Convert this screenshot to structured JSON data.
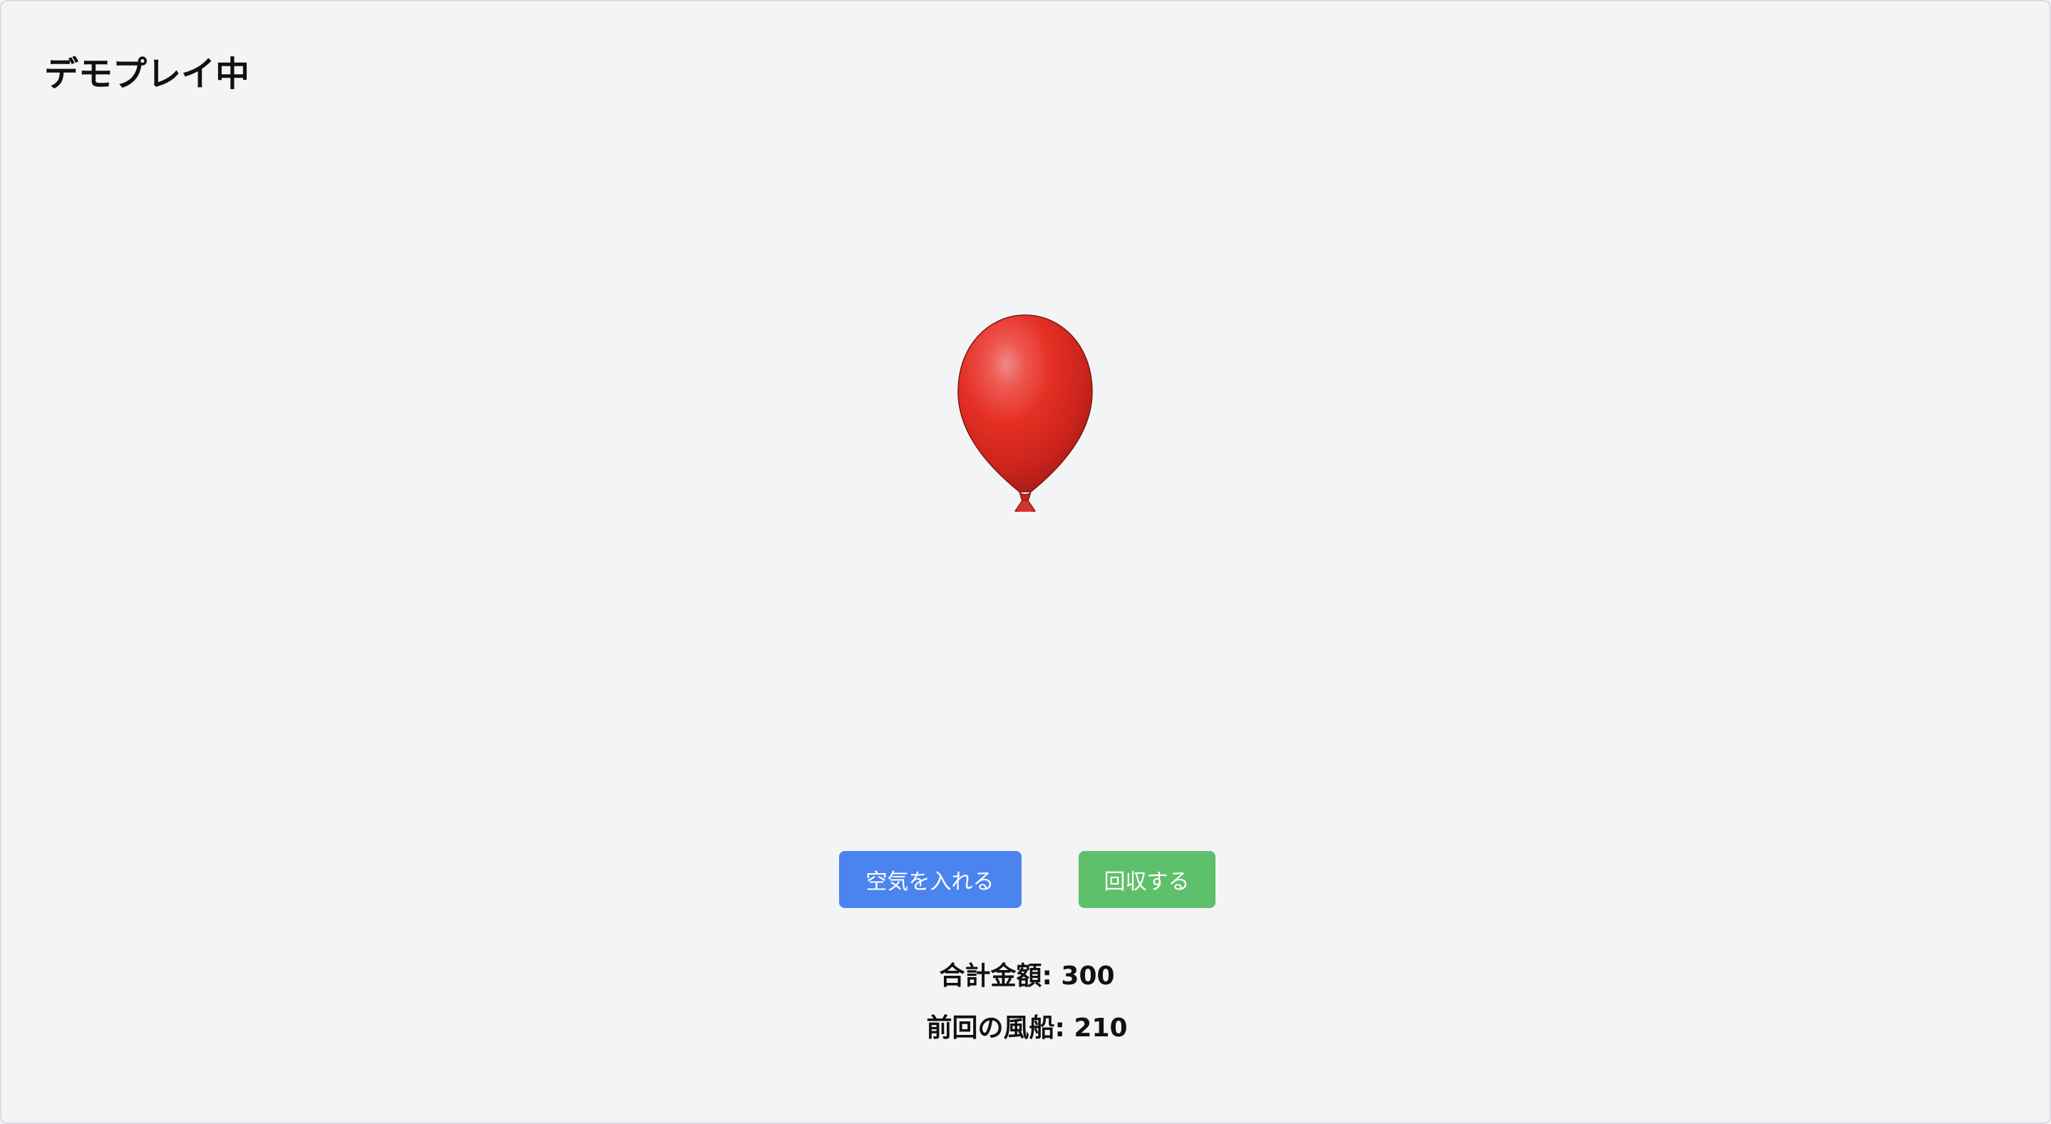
{
  "header": {
    "title": "デモプレイ中"
  },
  "balloon": {
    "icon": "balloon-icon",
    "color": "#e32b22"
  },
  "controls": {
    "pump_label": "空気を入れる",
    "pump_color": "#4b84ee",
    "collect_label": "回収する",
    "collect_color": "#5fc06b"
  },
  "stats": {
    "total_label": "合計金額: ",
    "total_value": "300",
    "last_label": "前回の風船: ",
    "last_value": "210"
  }
}
